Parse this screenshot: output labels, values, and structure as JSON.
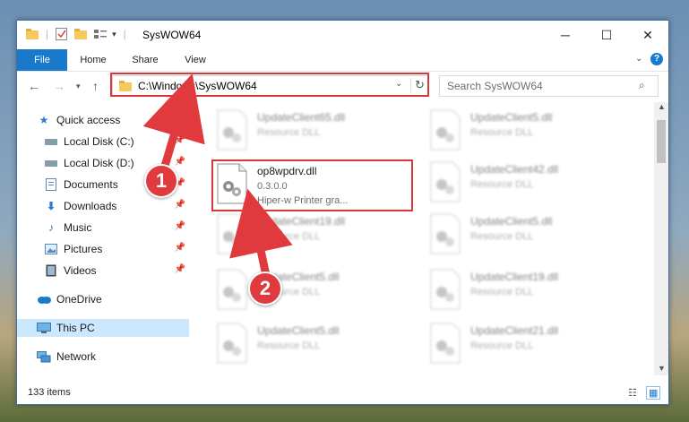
{
  "window": {
    "title": "SysWOW64"
  },
  "ribbon": {
    "tabs": [
      "File",
      "Home",
      "Share",
      "View"
    ]
  },
  "address": {
    "path": "C:\\Windows\\SysWOW64"
  },
  "search": {
    "placeholder": "Search SysWOW64"
  },
  "sidebar": {
    "items": [
      {
        "label": "Quick access",
        "icon": "star-icon",
        "pinned": false
      },
      {
        "label": "Local Disk (C:)",
        "icon": "drive-icon",
        "pinned": true
      },
      {
        "label": "Local Disk (D:)",
        "icon": "drive-icon",
        "pinned": true
      },
      {
        "label": "Documents",
        "icon": "documents-icon",
        "pinned": true
      },
      {
        "label": "Downloads",
        "icon": "download-icon",
        "pinned": true
      },
      {
        "label": "Music",
        "icon": "music-icon",
        "pinned": true
      },
      {
        "label": "Pictures",
        "icon": "pictures-icon",
        "pinned": true
      },
      {
        "label": "Videos",
        "icon": "videos-icon",
        "pinned": true
      },
      {
        "label": "OneDrive",
        "icon": "cloud-icon",
        "pinned": false
      },
      {
        "label": "This PC",
        "icon": "computer-icon",
        "pinned": false,
        "selected": true
      },
      {
        "label": "Network",
        "icon": "network-icon",
        "pinned": false
      }
    ]
  },
  "files": {
    "highlighted": {
      "name": "op8wpdrv.dll",
      "version": "0.3.0.0",
      "description": "Hiper-w Printer gra..."
    },
    "blurred": [
      {
        "name": "UpdateClient65.dll",
        "type": "Resource DLL"
      },
      {
        "name": "UpdateClient5.dll",
        "type": "Resource DLL"
      },
      {
        "name": "UpdateClient42.dll",
        "type": "Resource DLL"
      },
      {
        "name": "UpdateClient19.dll",
        "type": "Resource DLL"
      },
      {
        "name": "UpdateClient5.dll",
        "type": "Resource DLL"
      },
      {
        "name": "UpdateClient5.dll",
        "type": "Resource DLL"
      },
      {
        "name": "UpdateClient19.dll",
        "type": "Resource DLL"
      },
      {
        "name": "UpdateClient5.dll",
        "type": "Resource DLL"
      },
      {
        "name": "UpdateClient21.dll",
        "type": "Resource DLL"
      }
    ]
  },
  "status": {
    "items": "133 items"
  },
  "annotations": {
    "step1": "1",
    "step2": "2"
  },
  "colors": {
    "accent": "#1979ca",
    "highlight": "#d9373b"
  }
}
